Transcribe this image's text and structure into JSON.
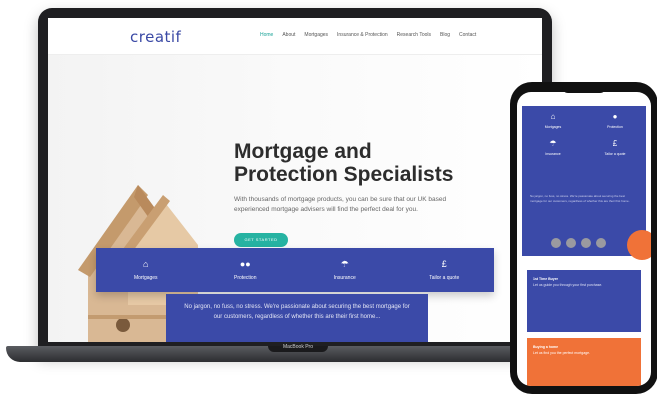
{
  "laptop": {
    "model_label": "MacBook Pro"
  },
  "site": {
    "logo": "creatif",
    "nav": [
      "Home",
      "About",
      "Mortgages",
      "Insurance & Protection",
      "Research Tools",
      "Blog",
      "Contact"
    ],
    "hero": {
      "title_line1": "Mortgage and",
      "title_line2": "Protection Specialists",
      "subtitle": "With thousands of mortgage products, you can be sure that our UK based experienced mortgage advisers will find the perfect deal for you.",
      "cta": "GET STARTED"
    },
    "services": [
      {
        "icon": "house-icon",
        "label": "Mortgages"
      },
      {
        "icon": "people-icon",
        "label": "Protection"
      },
      {
        "icon": "umbrella-icon",
        "label": "Insurance"
      },
      {
        "icon": "pound-icon",
        "label": "Tailor a quote"
      }
    ],
    "about_text": "No jargon, no fuss, no stress. We're passionate about securing the best mortgage for our customers, regardless of whether this are their first home..."
  },
  "phone": {
    "services": [
      {
        "icon": "house-icon",
        "label": "Mortgages"
      },
      {
        "icon": "people-icon",
        "label": "Protection"
      },
      {
        "icon": "umbrella-icon",
        "label": "Insurance"
      },
      {
        "icon": "pound-icon",
        "label": "Tailor a quote"
      }
    ],
    "blurb": "No jargon, no fuss, no stress. We're passionate about securing the best mortgage for our customers, regardless of whether this are their first home.",
    "card1_title": "1st Time Buyer",
    "card1_text": "Let us guide you through your first purchase.",
    "card2_title": "Buying a home",
    "card2_text": "Let us find you the perfect mortgage."
  },
  "colors": {
    "accent_blue": "#3b4aa8",
    "accent_teal": "#26b3a2",
    "accent_orange": "#f07238"
  }
}
